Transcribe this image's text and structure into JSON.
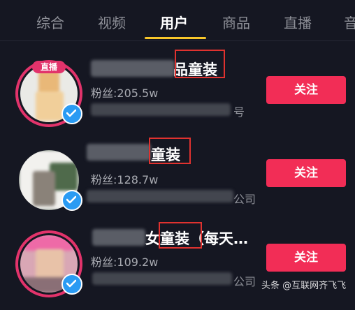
{
  "tabs": [
    {
      "label": "综合",
      "active": false
    },
    {
      "label": "视频",
      "active": false
    },
    {
      "label": "用户",
      "active": true
    },
    {
      "label": "商品",
      "active": false
    },
    {
      "label": "直播",
      "active": false
    },
    {
      "label": "音",
      "active": false
    }
  ],
  "users": [
    {
      "live_badge": "直播",
      "name_visible": "品",
      "name_highlight": "童装",
      "fans": "粉丝:205.5w",
      "desc_visible": "号",
      "button": "关注",
      "verified": true
    },
    {
      "name_visible": "",
      "name_highlight": "童装",
      "fans": "粉丝:128.7w",
      "desc_visible": "公司",
      "button": "关注",
      "verified": true
    },
    {
      "name_visible": "女",
      "name_highlight": "童装",
      "name_suffix": "（每天…",
      "fans": "粉丝:109.2w",
      "desc_visible": "公司",
      "button": "关注",
      "verified": true
    }
  ],
  "watermark": "头条 @互联网齐飞飞",
  "colors": {
    "background": "#151722",
    "accent": "#f22d56",
    "tab_indicator": "#f8c72a",
    "highlight_box": "#e0322f",
    "verified": "#2a9bf3"
  }
}
